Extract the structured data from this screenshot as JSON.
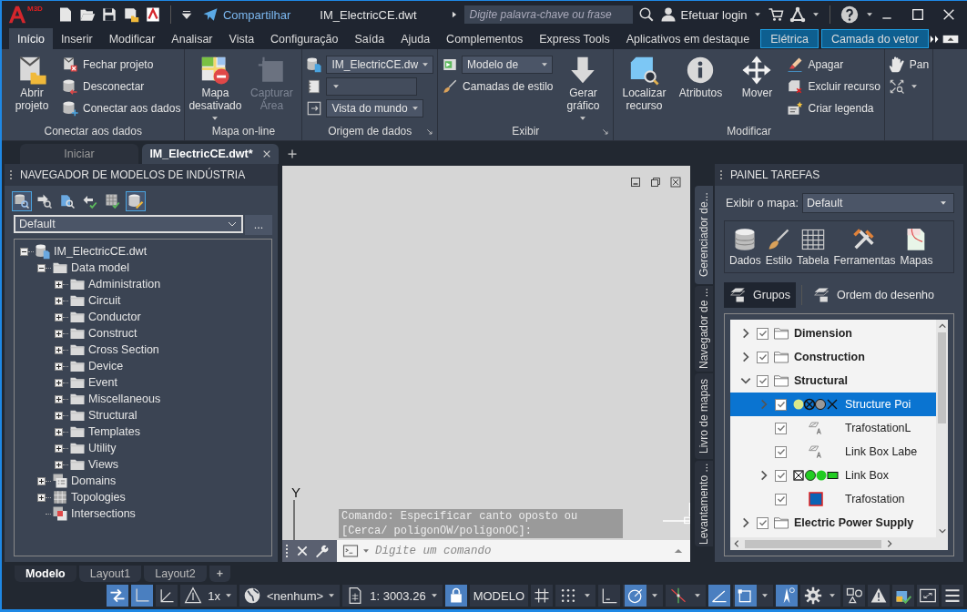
{
  "title_bar": {
    "app_badge": "M3D",
    "share": "Compartilhar",
    "file_name": "IM_ElectricCE.dwt",
    "search": {
      "placeholder": "Digite palavra-chave ou frase"
    },
    "login": "Efetuar login"
  },
  "ribbon_tabs": [
    {
      "label": "Início",
      "selected": true,
      "kind": "standard"
    },
    {
      "label": "Inserir",
      "selected": false,
      "kind": "standard"
    },
    {
      "label": "Modificar",
      "selected": false,
      "kind": "standard"
    },
    {
      "label": "Analisar",
      "selected": false,
      "kind": "standard"
    },
    {
      "label": "Vista",
      "selected": false,
      "kind": "standard"
    },
    {
      "label": "Configuração",
      "selected": false,
      "kind": "standard"
    },
    {
      "label": "Saída",
      "selected": false,
      "kind": "standard"
    },
    {
      "label": "Ajuda",
      "selected": false,
      "kind": "standard"
    },
    {
      "label": "Complementos",
      "selected": false,
      "kind": "standard"
    },
    {
      "label": "Express Tools",
      "selected": false,
      "kind": "standard"
    },
    {
      "label": "Aplicativos em destaque",
      "selected": false,
      "kind": "standard"
    },
    {
      "label": "Elétrica",
      "selected": false,
      "kind": "contextual"
    },
    {
      "label": "Camada do vetor",
      "selected": false,
      "kind": "contextual"
    }
  ],
  "ribbon_panels": [
    {
      "title": "Conectar aos dados",
      "launcher": false,
      "columns": [
        {
          "kind": "large",
          "items": [
            {
              "label": "Abrir projeto",
              "disabled": false
            }
          ]
        },
        {
          "kind": "stack",
          "items": [
            {
              "kind": "button",
              "label": "Fechar projeto"
            },
            {
              "kind": "button",
              "label": "Desconectar"
            },
            {
              "kind": "button",
              "label": "Conectar aos dados"
            }
          ]
        }
      ]
    },
    {
      "title": "Mapa on-line",
      "launcher": false,
      "columns": [
        {
          "kind": "split",
          "items": [
            {
              "label": "Mapa desativado",
              "disabled": false
            }
          ]
        },
        {
          "kind": "large",
          "items": [
            {
              "label": "Capturar Área",
              "disabled": true
            }
          ]
        }
      ]
    },
    {
      "title": "Origem de dados",
      "launcher": true,
      "columns": [
        {
          "kind": "stack",
          "items": [
            {
              "kind": "dropdown",
              "value": "IM_ElectricCE.dw"
            },
            {
              "kind": "dropdown"
            },
            {
              "kind": "dropdown",
              "value": "Vista do mundo"
            }
          ]
        }
      ]
    },
    {
      "title": "Exibir",
      "launcher": true,
      "columns": [
        {
          "kind": "stack",
          "items": [
            {
              "kind": "dropdown",
              "value": "Modelo de"
            },
            {
              "kind": "button",
              "label": "Camadas de estilo"
            }
          ]
        },
        {
          "kind": "split",
          "items": [
            {
              "label": "Gerar gráfico",
              "disabled": false
            }
          ]
        }
      ]
    },
    {
      "title": "Modificar",
      "launcher": false,
      "columns": [
        {
          "kind": "large",
          "items": [
            {
              "label": "Localizar recurso",
              "disabled": false
            }
          ]
        },
        {
          "kind": "large",
          "items": [
            {
              "label": "Atributos",
              "disabled": false
            }
          ]
        },
        {
          "kind": "large",
          "items": [
            {
              "label": "Mover",
              "disabled": false
            }
          ]
        },
        {
          "kind": "stack",
          "items": [
            {
              "kind": "button",
              "label": "Apagar"
            },
            {
              "kind": "button",
              "label": "Excluir recurso"
            },
            {
              "kind": "button",
              "label": "Criar legenda"
            }
          ]
        }
      ]
    },
    {
      "launcher": false,
      "columns": [
        {
          "kind": "stack",
          "items": [
            {
              "kind": "button",
              "label": "Pan"
            },
            {
              "kind": "icon"
            }
          ]
        }
      ]
    }
  ],
  "document_tabs": [
    {
      "label": "Iniciar",
      "selected": false
    },
    {
      "label": "IM_ElectricCE.dwt*",
      "selected": true
    }
  ],
  "model_navigator": {
    "title": "NAVEGADOR DE MODELOS DE INDÚSTRIA",
    "toolbar": [
      {
        "selected": true
      },
      {
        "selected": false
      },
      {
        "selected": false
      },
      {
        "selected": false
      },
      {
        "selected": false
      },
      {
        "selected": true
      }
    ],
    "profile": {
      "value": "Default",
      "more": "..."
    },
    "tree": [
      {
        "label": "IM_ElectricCE.dwt",
        "kind": "database",
        "expanded": true,
        "children": [
          {
            "label": "Data model",
            "kind": "folder",
            "expanded": true,
            "children": [
              {
                "label": "Administration",
                "kind": "folder",
                "expanded": false
              },
              {
                "label": "Circuit",
                "kind": "folder",
                "expanded": false
              },
              {
                "label": "Conductor",
                "kind": "folder",
                "expanded": false
              },
              {
                "label": "Construct",
                "kind": "folder",
                "expanded": false
              },
              {
                "label": "Cross Section",
                "kind": "folder",
                "expanded": false
              },
              {
                "label": "Device",
                "kind": "folder",
                "expanded": false
              },
              {
                "label": "Event",
                "kind": "folder",
                "expanded": false
              },
              {
                "label": "Miscellaneous",
                "kind": "folder",
                "expanded": false
              },
              {
                "label": "Structural",
                "kind": "folder",
                "expanded": false
              },
              {
                "label": "Templates",
                "kind": "folder",
                "expanded": false
              },
              {
                "label": "Utility",
                "kind": "folder",
                "expanded": false
              },
              {
                "label": "Views",
                "kind": "folder",
                "expanded": false
              }
            ]
          },
          {
            "label": "Domains",
            "kind": "domains",
            "expanded": false
          },
          {
            "label": "Topologies",
            "kind": "topologies",
            "expanded": false
          },
          {
            "label": "Intersections",
            "kind": "intersections"
          }
        ]
      }
    ]
  },
  "canvas": {
    "axis_label": "Y",
    "history": "Comando: Especificar canto oposto ou [Cerca/ polígonOW/polígonOC]:",
    "command_line": {
      "placeholder": "Digite um comando"
    }
  },
  "layout_tabs": [
    {
      "label": "Modelo",
      "selected": true
    },
    {
      "label": "Layout1",
      "selected": false
    },
    {
      "label": "Layout2",
      "selected": false
    }
  ],
  "layout_add": "+",
  "task_pane": {
    "title": "PAINEL TAREFAS",
    "side_tabs": [
      {
        "label": "Gerenciador de...",
        "selected": true
      },
      {
        "label": "Navegador de ...",
        "selected": false
      },
      {
        "label": "Livro de mapas",
        "selected": false
      },
      {
        "label": "Levantamento ...",
        "selected": false
      }
    ],
    "map_label": "Exibir o mapa:",
    "map_value": "Default",
    "tools": [
      {
        "label": "Dados"
      },
      {
        "label": "Estilo"
      },
      {
        "label": "Tabela"
      },
      {
        "label": "Ferramentas"
      },
      {
        "label": "Mapas"
      }
    ],
    "views": [
      {
        "label": "Grupos",
        "selected": true
      },
      {
        "label": "Ordem do desenho",
        "selected": false
      }
    ],
    "layers": [
      {
        "label": "Dimension",
        "kind": "group",
        "checked": true,
        "selected": false,
        "expanded": false
      },
      {
        "label": "Construction",
        "kind": "group",
        "checked": true,
        "selected": false,
        "expanded": false
      },
      {
        "label": "Structural",
        "kind": "group",
        "checked": true,
        "selected": false,
        "expanded": true,
        "children": [
          {
            "label": "Structure Poi",
            "kind": "points",
            "checked": true,
            "selected": true,
            "expanded": false
          },
          {
            "label": "TrafostationL",
            "kind": "labels",
            "checked": true,
            "selected": false
          },
          {
            "label": "Link Box Labe",
            "kind": "labels",
            "checked": true,
            "selected": false
          },
          {
            "label": "Link Box",
            "kind": "boxes",
            "checked": true,
            "selected": false,
            "expanded": false
          },
          {
            "label": "Trafostation",
            "kind": "area",
            "checked": true,
            "selected": false
          }
        ]
      },
      {
        "label": "Electric Power Supply",
        "kind": "group",
        "checked": true,
        "selected": false,
        "expanded": false
      }
    ]
  },
  "status_bar": [
    {
      "kind": "toggle",
      "on": true
    },
    {
      "kind": "toggle",
      "on": true
    },
    {
      "kind": "toggle",
      "on": false
    },
    {
      "kind": "dropdown",
      "label": "1x",
      "on": false
    },
    {
      "kind": "dropdown",
      "label": "<nenhum>",
      "on": false
    },
    {
      "kind": "dropdown",
      "label": "1: 3003.26",
      "on": false
    },
    {
      "kind": "toggle",
      "on": true
    },
    {
      "kind": "text",
      "label": "MODELO",
      "on": false
    },
    {
      "kind": "toggle",
      "on": false
    },
    {
      "kind": "dropdown",
      "on": false
    },
    {
      "kind": "toggle",
      "on": false
    },
    {
      "kind": "dropdown",
      "on": true
    },
    {
      "kind": "dropdown",
      "on": false
    },
    {
      "kind": "toggle",
      "on": true
    },
    {
      "kind": "dropdown",
      "on": true
    },
    {
      "kind": "toggle",
      "on": true
    },
    {
      "kind": "dropdown",
      "on": false
    },
    {
      "kind": "toggle",
      "on": false
    },
    {
      "kind": "toggle",
      "on": false
    },
    {
      "kind": "toggle",
      "on": false
    },
    {
      "kind": "toggle",
      "on": false
    },
    {
      "kind": "toggle",
      "on": false
    }
  ]
}
